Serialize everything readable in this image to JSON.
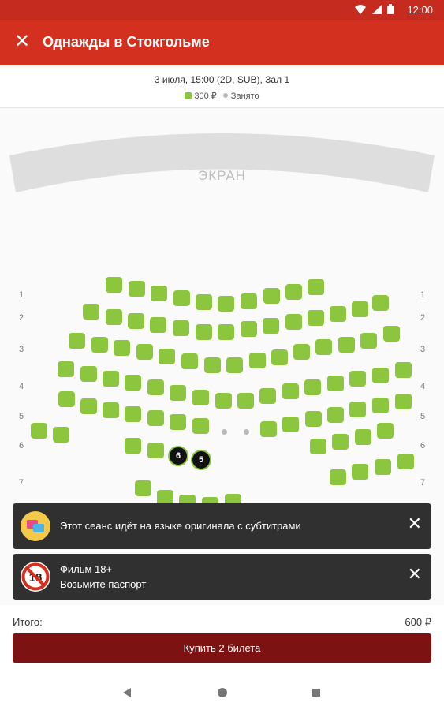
{
  "status": {
    "time": "12:00",
    "icons": [
      "wifi-icon",
      "signal-icon",
      "battery-icon"
    ]
  },
  "header": {
    "close_icon": "✕",
    "title": "Однажды в Стокгольме"
  },
  "session": {
    "info": "3 июля, 15:00 (2D, SUB), Зал 1",
    "legend": {
      "price": "300 ₽",
      "taken": "Занято"
    }
  },
  "screen_label": "ЭКРАН",
  "row_labels": [
    "1",
    "2",
    "3",
    "4",
    "5",
    "6",
    "7"
  ],
  "colors": {
    "free": "#8cc63f",
    "taken": "#b9b9b9",
    "selected": "#111111",
    "accent": "#d4301f",
    "buy": "#7d1212"
  },
  "selected_seats": [
    "6",
    "5"
  ],
  "notices": [
    {
      "icon": "subtitles-icon",
      "text": "Этот сеанс идёт на языке оригинала с субтитрами"
    },
    {
      "icon": "age-18-icon",
      "title": "Фильм 18+",
      "text": "Возьмите паспорт"
    }
  ],
  "footer": {
    "total_label": "Итого:",
    "total_value": "600 ₽",
    "buy_label": "Купить 2 билета"
  },
  "nav": [
    "back-icon",
    "home-icon",
    "recent-apps-icon"
  ]
}
